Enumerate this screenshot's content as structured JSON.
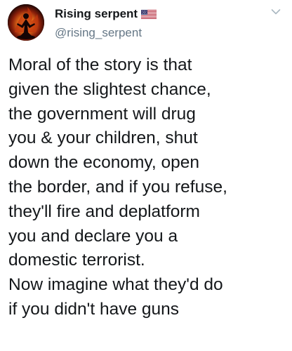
{
  "tweet": {
    "author": {
      "display_name": "Rising serpent",
      "handle": "@rising_serpent",
      "flag_icon": "us-flag-icon",
      "avatar_icon": "flaming-figure-avatar"
    },
    "menu_icon": "chevron-down-icon",
    "text_lines": [
      "Moral of the story is that",
      "given the slightest chance,",
      "the government will drug",
      "you & your children, shut",
      "down the economy, open",
      "the border, and if you refuse,",
      "they'll fire and deplatform",
      "you and declare you a",
      "domestic terrorist.",
      "Now imagine what they'd do",
      "if you didn't have guns"
    ]
  },
  "colors": {
    "text": "#14171a",
    "secondary_text": "#657786",
    "caret": "#aab8c2",
    "background": "#ffffff"
  }
}
